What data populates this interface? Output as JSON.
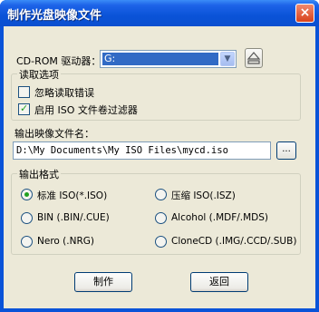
{
  "window": {
    "title": "制作光盘映像文件",
    "close_glyph": "×"
  },
  "drive": {
    "label": "CD-ROM 驱动器：",
    "selected": "G:",
    "eject_icon": "eject-icon"
  },
  "read_options": {
    "legend": "读取选项",
    "ignore_errors": {
      "label": "忽略读取错误",
      "checked": false
    },
    "iso_filter": {
      "label": "启用 ISO 文件卷过滤器",
      "checked": true
    }
  },
  "output_file": {
    "label": "输出映像文件名：",
    "value": "D:\\My Documents\\My ISO Files\\mycd.iso",
    "browse_label": "..."
  },
  "output_format": {
    "legend": "输出格式",
    "options": [
      {
        "label": "标准 ISO(*.ISO)",
        "checked": true
      },
      {
        "label": "压缩 ISO(.ISZ)",
        "checked": false
      },
      {
        "label": "BIN (.BIN/.CUE)",
        "checked": false
      },
      {
        "label": "Alcohol (.MDF/.MDS)",
        "checked": false
      },
      {
        "label": "Nero (.NRG)",
        "checked": false
      },
      {
        "label": "CloneCD (.IMG/.CCD/.SUB)",
        "checked": false
      }
    ]
  },
  "buttons": {
    "make": "制作",
    "back": "返回"
  },
  "colors": {
    "titlebar": "#0a53d8",
    "dialog_bg": "#ece9d8",
    "selection": "#316ac5",
    "check": "#21a121"
  }
}
